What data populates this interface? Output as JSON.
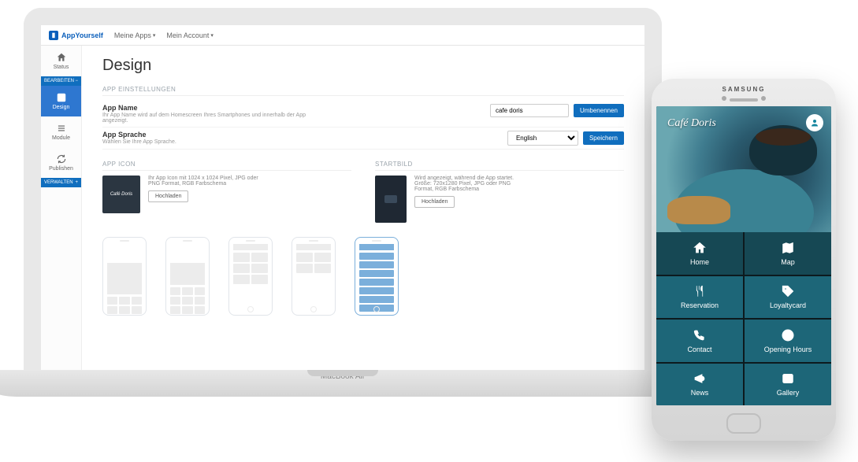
{
  "brand": "AppYourself",
  "nav": {
    "apps": "Meine Apps",
    "account": "Mein Account"
  },
  "sidebar": {
    "status": "Status",
    "bearbeiten": "BEARBEITEN",
    "design": "Design",
    "module": "Module",
    "publish": "Publishen",
    "verwalten": "VERWALTEN"
  },
  "page": {
    "title": "Design",
    "settings_section": "APP EINSTELLUNGEN",
    "app_name_label": "App Name",
    "app_name_desc": "Ihr App Name wird auf dem Homescreen Ihres Smartphones und innerhalb der App angezeigt.",
    "app_name_value": "cafe doris",
    "rename_btn": "Umbenennen",
    "lang_label": "App Sprache",
    "lang_desc": "Wählen Sie Ihre App Sprache.",
    "lang_value": "English",
    "save_btn": "Speichern",
    "icon_section": "APP ICON",
    "icon_desc": "Ihr App Icon mit 1024 x 1024 Pixel, JPG oder PNG Format, RGB Farbschema",
    "splash_section": "STARTBILD",
    "splash_desc": "Wird angezeigt, während die App startet. Größe: 720x1280 Pixel, JPG oder PNG Format, RGB Farbschema",
    "upload_btn": "Hochladen",
    "icon_preview_text": "Café Doris"
  },
  "laptop_base": "MacBook Air",
  "phone_mock": {
    "device": "SAMSUNG",
    "app_title": "Café Doris",
    "tiles": [
      "Home",
      "Map",
      "Reservation",
      "Loyaltycard",
      "Contact",
      "Opening Hours",
      "News",
      "Gallery"
    ]
  }
}
